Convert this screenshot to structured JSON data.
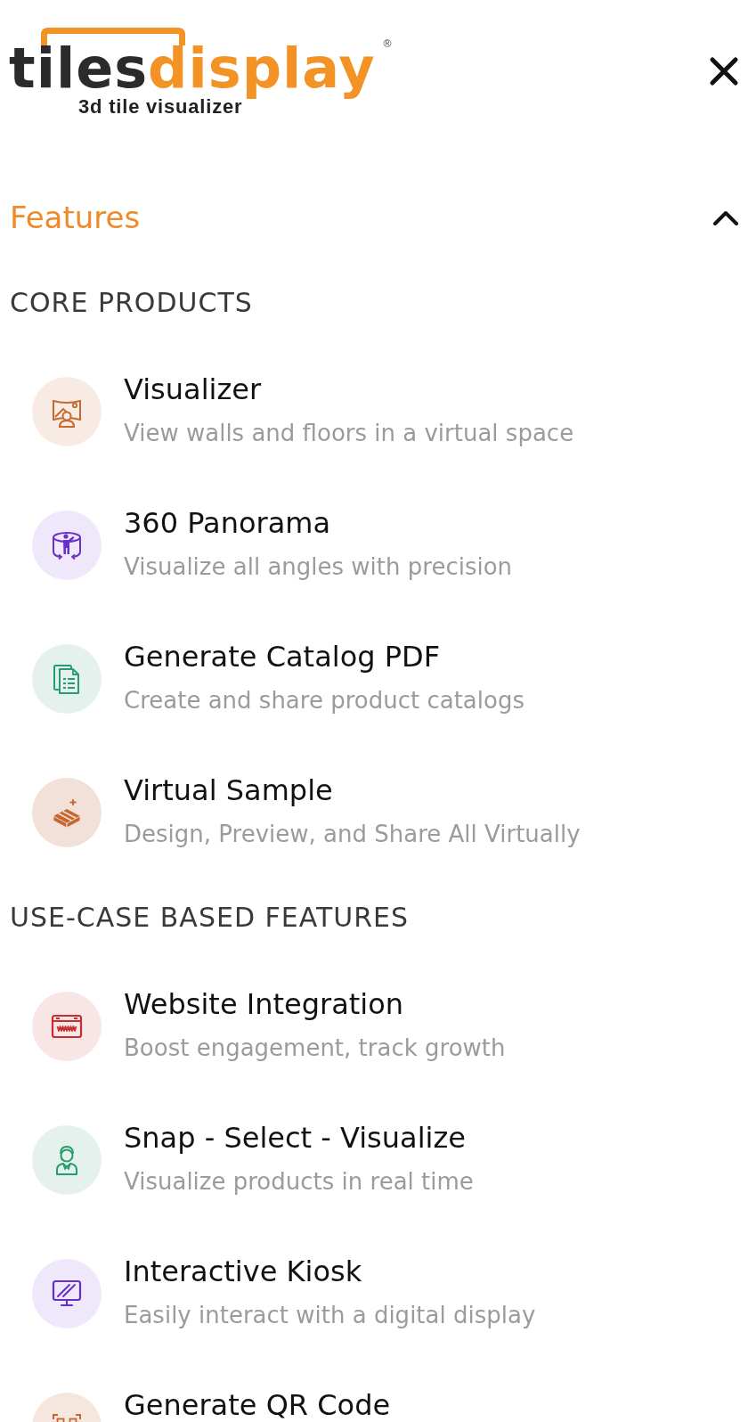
{
  "header": {
    "logo": {
      "word_dark": "tiles",
      "word_accent": "display",
      "registered": "®",
      "tagline": "3d tile visualizer"
    }
  },
  "menu": {
    "title": "Features",
    "expanded": true,
    "sections": [
      {
        "heading": "CORE PRODUCTS",
        "items": [
          {
            "kind": "visualizer",
            "color": "#f8ebe3",
            "title": "Visualizer",
            "subtitle": "View walls and floors in a virtual space"
          },
          {
            "kind": "panorama",
            "color": "#efe8fa",
            "title": "360 Panorama",
            "subtitle": "Visualize all angles with precision"
          },
          {
            "kind": "catalog",
            "color": "#e4f1ec",
            "title": "Generate Catalog PDF",
            "subtitle": "Create and share product catalogs"
          },
          {
            "kind": "sample",
            "color": "#f1e1d8",
            "title": "Virtual Sample",
            "subtitle": "Design, Preview, and Share All Virtually"
          }
        ]
      },
      {
        "heading": "USE-CASE BASED FEATURES",
        "items": [
          {
            "kind": "website",
            "color": "#f8e6e6",
            "title": "Website Integration",
            "subtitle": "Boost engagement, track growth"
          },
          {
            "kind": "snap",
            "color": "#e5f1ec",
            "title": "Snap - Select - Visualize",
            "subtitle": "Visualize products in real time"
          },
          {
            "kind": "kiosk",
            "color": "#efe8fa",
            "title": "Interactive Kiosk",
            "subtitle": "Easily interact with a digital display"
          },
          {
            "kind": "qr",
            "color": "#f6e7de",
            "title": "Generate QR Code"
          }
        ]
      }
    ]
  }
}
